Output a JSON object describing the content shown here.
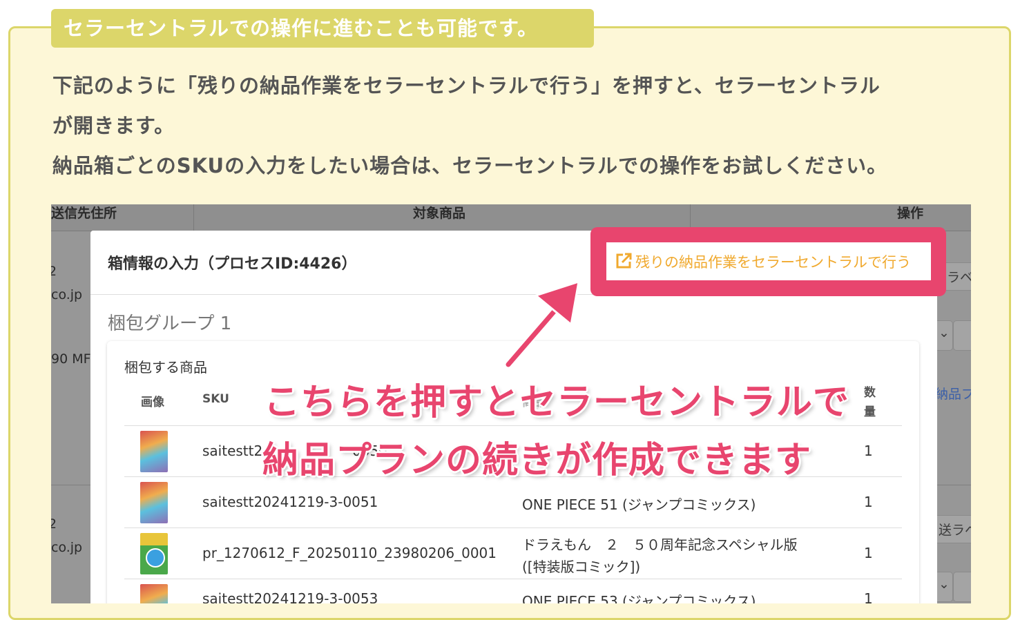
{
  "note": {
    "tab_title": "セラーセントラルでの操作に進むことも可能です。",
    "line1": "下記のように「残りの納品作業をセラーセントラルで行う」を押すと、セラーセントラル",
    "line2": "が開きます。",
    "line3": "納品箱ごとのSKUの入力をしたい場合は、セラーセントラルでの操作をお試しください。"
  },
  "background_table": {
    "headers": [
      "送信先住所",
      "対象商品",
      "操作"
    ],
    "row_fragments": {
      "a1": "2",
      "a2": "co.jp",
      "a3": "90 MF",
      "a4": "2",
      "a5": "co.jp",
      "b1": "ラベ",
      "b2": "納品プ",
      "b3": "送ラベ"
    }
  },
  "modal": {
    "title": "箱情報の入力（プロセスID:4426）",
    "cta_label": "残りの納品作業をセラーセントラルで行う",
    "group_title": "梱包グループ 1",
    "card_heading": "梱包する商品",
    "columns": {
      "image": "画像",
      "sku": "SKU",
      "product": "商品",
      "qty_line1": "数",
      "qty_line2": "量"
    },
    "rows": [
      {
        "thumb": "one-piece-cover",
        "sku": "saitestt2",
        "sku_tail": "0050",
        "name": "",
        "qty": "1"
      },
      {
        "thumb": "one-piece-cover",
        "sku": "saitestt20241219-3-0051",
        "name": "ONE PIECE 51 (ジャンプコミックス)",
        "name_line2": "",
        "qty": "1"
      },
      {
        "thumb": "doraemon-cover",
        "sku": "pr_1270612_F_20250110_23980206_0001",
        "name": "ドラえもん　２　５０周年記念スペシャル版",
        "name_line2": "([特装版コミック])",
        "qty": "1"
      },
      {
        "thumb": "one-piece-cover",
        "sku": "saitestt20241219-3-0053",
        "name": "ONE PIECE 53 (ジャンプコミックス)",
        "name_line2": "",
        "qty": "1"
      }
    ]
  },
  "callout": {
    "line1": "こちらを押すとセラーセントラルで",
    "line2": "納品プランの続きが作成できます"
  },
  "colors": {
    "note_bg": "#fdf7d7",
    "note_border": "#dcd66a",
    "accent_pink": "#e8456e",
    "cta_orange": "#f0a92e"
  }
}
